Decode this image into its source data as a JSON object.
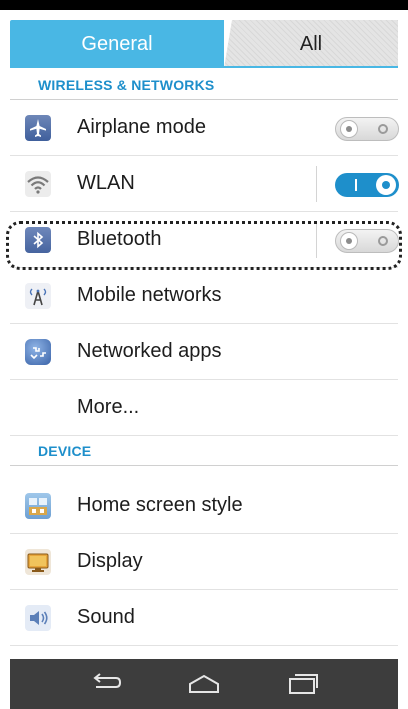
{
  "tabs": {
    "general": "General",
    "all": "All"
  },
  "sections": {
    "wireless": "WIRELESS & NETWORKS",
    "device": "DEVICE"
  },
  "rows": {
    "airplane": {
      "label": "Airplane mode",
      "toggle": "off",
      "icon": "airplane-icon"
    },
    "wlan": {
      "label": "WLAN",
      "toggle": "on",
      "icon": "wifi-icon"
    },
    "bluetooth": {
      "label": "Bluetooth",
      "toggle": "off",
      "icon": "bluetooth-icon"
    },
    "mobile": {
      "label": "Mobile networks",
      "icon": "antenna-icon"
    },
    "networked": {
      "label": "Networked apps",
      "icon": "globe-icon"
    },
    "more": {
      "label": "More..."
    },
    "home_style": {
      "label": "Home screen style",
      "icon": "home-screen-icon"
    },
    "display": {
      "label": "Display",
      "icon": "display-icon"
    },
    "sound": {
      "label": "Sound",
      "icon": "speaker-icon"
    }
  },
  "navbar": {
    "back": "back-icon",
    "home": "home-icon",
    "recents": "recents-icon"
  },
  "colors": {
    "accent": "#49b7e4",
    "section_text": "#1e8fcb",
    "navbar": "#3d3d3d"
  }
}
